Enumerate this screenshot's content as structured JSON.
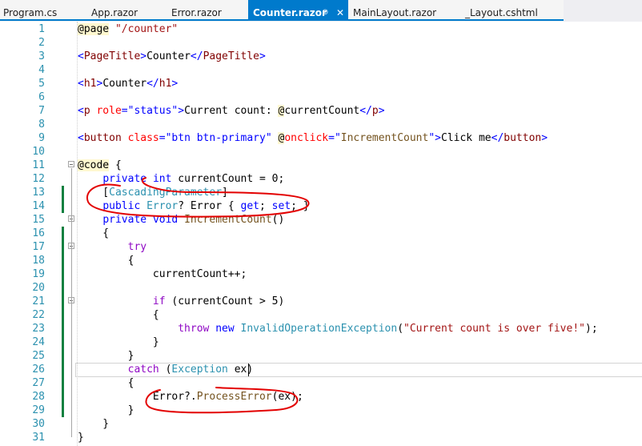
{
  "tabs": [
    {
      "label": "Program.cs",
      "active": false
    },
    {
      "label": "App.razor",
      "active": false
    },
    {
      "label": "Error.razor",
      "active": false
    },
    {
      "label": "Counter.razor",
      "active": true
    },
    {
      "label": "MainLayout.razor",
      "active": false
    },
    {
      "label": "_Layout.cshtml",
      "active": false
    }
  ],
  "active_tab_icons": {
    "pin": "pin-icon",
    "close": "close-icon"
  },
  "colors": {
    "accent": "#007acc",
    "change_bar": "#108040",
    "annotation": "#e30000"
  },
  "lines": [
    {
      "n": "1",
      "tokens": [
        {
          "t": "@page",
          "c": "razor"
        },
        {
          "t": " "
        },
        {
          "t": "\"/counter\"",
          "c": "str"
        }
      ]
    },
    {
      "n": "2",
      "tokens": []
    },
    {
      "n": "3",
      "tokens": [
        {
          "t": "<",
          "c": "k"
        },
        {
          "t": "PageTitle",
          "c": "tag"
        },
        {
          "t": ">",
          "c": "k"
        },
        {
          "t": "Counter"
        },
        {
          "t": "</",
          "c": "k"
        },
        {
          "t": "PageTitle",
          "c": "tag"
        },
        {
          "t": ">",
          "c": "k"
        }
      ]
    },
    {
      "n": "4",
      "tokens": []
    },
    {
      "n": "5",
      "tokens": [
        {
          "t": "<",
          "c": "k"
        },
        {
          "t": "h1",
          "c": "tag"
        },
        {
          "t": ">",
          "c": "k"
        },
        {
          "t": "Counter"
        },
        {
          "t": "</",
          "c": "k"
        },
        {
          "t": "h1",
          "c": "tag"
        },
        {
          "t": ">",
          "c": "k"
        }
      ]
    },
    {
      "n": "6",
      "tokens": []
    },
    {
      "n": "7",
      "tokens": [
        {
          "t": "<",
          "c": "k"
        },
        {
          "t": "p",
          "c": "tag"
        },
        {
          "t": " "
        },
        {
          "t": "role",
          "c": "attr"
        },
        {
          "t": "=",
          "c": "k"
        },
        {
          "t": "\"status\"",
          "c": "k"
        },
        {
          "t": ">",
          "c": "k"
        },
        {
          "t": "Current count: "
        },
        {
          "t": "@",
          "c": "razor"
        },
        {
          "t": "currentCount"
        },
        {
          "t": "</",
          "c": "k"
        },
        {
          "t": "p",
          "c": "tag"
        },
        {
          "t": ">",
          "c": "k"
        }
      ]
    },
    {
      "n": "8",
      "tokens": []
    },
    {
      "n": "9",
      "tokens": [
        {
          "t": "<",
          "c": "k"
        },
        {
          "t": "button",
          "c": "tag"
        },
        {
          "t": " "
        },
        {
          "t": "class",
          "c": "attr"
        },
        {
          "t": "=",
          "c": "k"
        },
        {
          "t": "\"btn btn-primary\"",
          "c": "k"
        },
        {
          "t": " "
        },
        {
          "t": "@",
          "c": "razor"
        },
        {
          "t": "onclick",
          "c": "attr"
        },
        {
          "t": "=",
          "c": "k"
        },
        {
          "t": "\"",
          "c": "k"
        },
        {
          "t": "IncrementCount",
          "c": "meth"
        },
        {
          "t": "\"",
          "c": "k"
        },
        {
          "t": ">",
          "c": "k"
        },
        {
          "t": "Click me"
        },
        {
          "t": "</",
          "c": "k"
        },
        {
          "t": "button",
          "c": "tag"
        },
        {
          "t": ">",
          "c": "k"
        }
      ]
    },
    {
      "n": "10",
      "tokens": []
    },
    {
      "n": "11",
      "tokens": [
        {
          "t": "@code",
          "c": "razor"
        },
        {
          "t": " {"
        }
      ]
    },
    {
      "n": "12",
      "tokens": [
        {
          "t": "    "
        },
        {
          "t": "private",
          "c": "k"
        },
        {
          "t": " "
        },
        {
          "t": "int",
          "c": "k"
        },
        {
          "t": " currentCount = 0;"
        }
      ]
    },
    {
      "n": "13",
      "tokens": [
        {
          "t": "    ["
        },
        {
          "t": "CascadingParameter",
          "c": "type"
        },
        {
          "t": "]"
        }
      ]
    },
    {
      "n": "14",
      "tokens": [
        {
          "t": "    "
        },
        {
          "t": "public",
          "c": "k"
        },
        {
          "t": " "
        },
        {
          "t": "Error",
          "c": "type"
        },
        {
          "t": "? Error { "
        },
        {
          "t": "get",
          "c": "k"
        },
        {
          "t": "; "
        },
        {
          "t": "set",
          "c": "k"
        },
        {
          "t": "; }"
        }
      ]
    },
    {
      "n": "15",
      "tokens": [
        {
          "t": "    "
        },
        {
          "t": "private",
          "c": "k"
        },
        {
          "t": " "
        },
        {
          "t": "void",
          "c": "k"
        },
        {
          "t": " "
        },
        {
          "t": "IncrementCount",
          "c": "meth"
        },
        {
          "t": "()"
        }
      ]
    },
    {
      "n": "16",
      "tokens": [
        {
          "t": "    {"
        }
      ]
    },
    {
      "n": "17",
      "tokens": [
        {
          "t": "        "
        },
        {
          "t": "try",
          "c": "ctl"
        }
      ]
    },
    {
      "n": "18",
      "tokens": [
        {
          "t": "        {"
        }
      ]
    },
    {
      "n": "19",
      "tokens": [
        {
          "t": "            currentCount++;"
        }
      ]
    },
    {
      "n": "20",
      "tokens": []
    },
    {
      "n": "21",
      "tokens": [
        {
          "t": "            "
        },
        {
          "t": "if",
          "c": "ctl"
        },
        {
          "t": " (currentCount > 5)"
        }
      ]
    },
    {
      "n": "22",
      "tokens": [
        {
          "t": "            {"
        }
      ]
    },
    {
      "n": "23",
      "tokens": [
        {
          "t": "                "
        },
        {
          "t": "throw",
          "c": "ctl"
        },
        {
          "t": " "
        },
        {
          "t": "new",
          "c": "k"
        },
        {
          "t": " "
        },
        {
          "t": "InvalidOperationException",
          "c": "type"
        },
        {
          "t": "("
        },
        {
          "t": "\"Current count is over five!\"",
          "c": "str"
        },
        {
          "t": ");"
        }
      ]
    },
    {
      "n": "24",
      "tokens": [
        {
          "t": "            }"
        }
      ]
    },
    {
      "n": "25",
      "tokens": [
        {
          "t": "        }"
        }
      ]
    },
    {
      "n": "26",
      "tokens": [
        {
          "t": "        "
        },
        {
          "t": "catch",
          "c": "ctl"
        },
        {
          "t": " ("
        },
        {
          "t": "Exception",
          "c": "type"
        },
        {
          "t": " ex)"
        }
      ]
    },
    {
      "n": "27",
      "tokens": [
        {
          "t": "        {"
        }
      ]
    },
    {
      "n": "28",
      "tokens": [
        {
          "t": "            Error?."
        },
        {
          "t": "ProcessError",
          "c": "meth"
        },
        {
          "t": "(ex);"
        }
      ]
    },
    {
      "n": "29",
      "tokens": [
        {
          "t": "        }"
        }
      ]
    },
    {
      "n": "30",
      "tokens": [
        {
          "t": "    }"
        }
      ]
    },
    {
      "n": "31",
      "tokens": [
        {
          "t": "}"
        }
      ]
    }
  ],
  "changed_lines": [
    "13",
    "14",
    "16",
    "17",
    "18",
    "19",
    "20",
    "21",
    "22",
    "23",
    "24",
    "25",
    "26",
    "27",
    "28",
    "29"
  ],
  "fold_lines": [
    "11",
    "15",
    "17",
    "21"
  ]
}
